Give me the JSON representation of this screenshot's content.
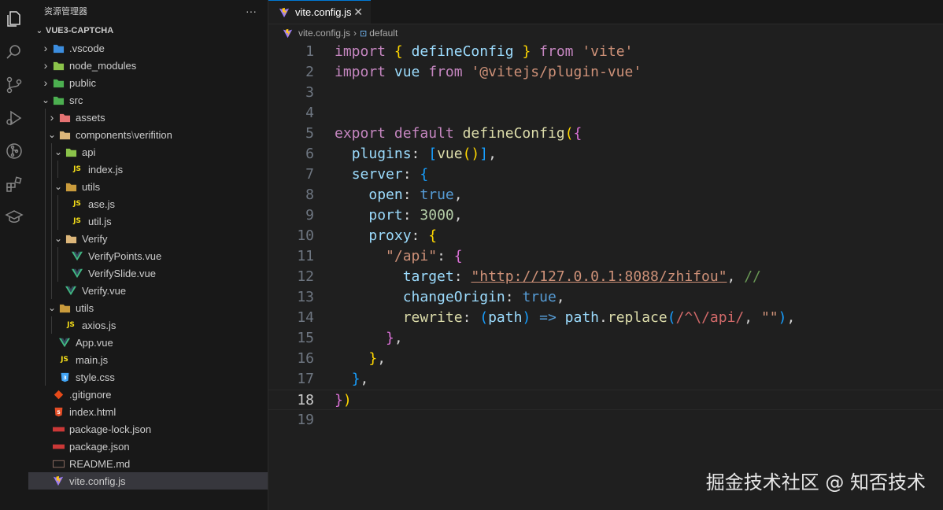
{
  "activity_bar": {
    "icons": [
      "files-icon",
      "search-icon",
      "source-control-icon",
      "run-debug-icon",
      "git-graph-icon",
      "extensions-icon",
      "education-icon"
    ]
  },
  "explorer": {
    "header": "资源管理器",
    "more": "···",
    "project": "VUE3-CAPTCHA",
    "items": [
      {
        "label": ".vscode",
        "depth": 1,
        "type": "folder",
        "icon": "vscode-folder",
        "color": "#3c8dde"
      },
      {
        "label": "node_modules",
        "depth": 1,
        "type": "folder",
        "icon": "node-folder",
        "color": "#8bc34a"
      },
      {
        "label": "public",
        "depth": 1,
        "type": "folder",
        "icon": "public-folder",
        "color": "#4caf50"
      },
      {
        "label": "src",
        "depth": 1,
        "type": "folder-open",
        "icon": "src-folder",
        "color": "#4caf50"
      },
      {
        "label": "assets",
        "depth": 2,
        "type": "folder",
        "icon": "assets-folder",
        "color": "#e57373"
      },
      {
        "label": "components",
        "sub": "verifition",
        "depth": 2,
        "type": "folder-open",
        "icon": "folder",
        "color": "#dcb67a"
      },
      {
        "label": "api",
        "depth": 3,
        "type": "folder-open",
        "icon": "api-folder",
        "color": "#8bc34a"
      },
      {
        "label": "index.js",
        "depth": 4,
        "type": "js",
        "icon": "js-file"
      },
      {
        "label": "utils",
        "depth": 3,
        "type": "folder-open",
        "icon": "utils-folder",
        "color": "#c99b3c"
      },
      {
        "label": "ase.js",
        "depth": 4,
        "type": "js",
        "icon": "js-file"
      },
      {
        "label": "util.js",
        "depth": 4,
        "type": "js",
        "icon": "js-file"
      },
      {
        "label": "Verify",
        "depth": 3,
        "type": "folder-open",
        "icon": "folder",
        "color": "#dcb67a"
      },
      {
        "label": "VerifyPoints.vue",
        "depth": 4,
        "type": "vue",
        "icon": "vue-file"
      },
      {
        "label": "VerifySlide.vue",
        "depth": 4,
        "type": "vue",
        "icon": "vue-file"
      },
      {
        "label": "Verify.vue",
        "depth": 3,
        "type": "vue",
        "icon": "vue-file"
      },
      {
        "label": "utils",
        "depth": 2,
        "type": "folder-open",
        "icon": "utils-folder",
        "color": "#c99b3c"
      },
      {
        "label": "axios.js",
        "depth": 3,
        "type": "js",
        "icon": "js-file"
      },
      {
        "label": "App.vue",
        "depth": 2,
        "type": "vue",
        "icon": "vue-file"
      },
      {
        "label": "main.js",
        "depth": 2,
        "type": "js",
        "icon": "js-file"
      },
      {
        "label": "style.css",
        "depth": 2,
        "type": "css",
        "icon": "css-file"
      },
      {
        "label": ".gitignore",
        "depth": 1,
        "type": "git",
        "icon": "git-file"
      },
      {
        "label": "index.html",
        "depth": 1,
        "type": "html",
        "icon": "html-file"
      },
      {
        "label": "package-lock.json",
        "depth": 1,
        "type": "npm",
        "icon": "npm-file"
      },
      {
        "label": "package.json",
        "depth": 1,
        "type": "npm",
        "icon": "npm-file"
      },
      {
        "label": "README.md",
        "depth": 1,
        "type": "md",
        "icon": "markdown-file"
      },
      {
        "label": "vite.config.js",
        "depth": 1,
        "type": "vite",
        "icon": "vite-file",
        "selected": true
      }
    ]
  },
  "editor": {
    "tab_label": "vite.config.js",
    "tab_close": "✕",
    "breadcrumb_file": "vite.config.js",
    "breadcrumb_sep": "›",
    "breadcrumb_symbol": "default",
    "current_line": 18,
    "lines": [
      [
        [
          "kw",
          "import"
        ],
        [
          "w",
          " "
        ],
        [
          "p1",
          "{"
        ],
        [
          "w",
          " "
        ],
        [
          "id",
          "defineConfig"
        ],
        [
          "w",
          " "
        ],
        [
          "p1",
          "}"
        ],
        [
          "w",
          " "
        ],
        [
          "kw",
          "from"
        ],
        [
          "w",
          " "
        ],
        [
          "str",
          "'vite'"
        ]
      ],
      [
        [
          "kw",
          "import"
        ],
        [
          "w",
          " "
        ],
        [
          "id",
          "vue"
        ],
        [
          "w",
          " "
        ],
        [
          "kw",
          "from"
        ],
        [
          "w",
          " "
        ],
        [
          "str",
          "'@vitejs/plugin-vue'"
        ]
      ],
      [],
      [],
      [
        [
          "kw",
          "export"
        ],
        [
          "w",
          " "
        ],
        [
          "kw",
          "default"
        ],
        [
          "w",
          " "
        ],
        [
          "fn",
          "defineConfig"
        ],
        [
          "p1",
          "("
        ],
        [
          "p2",
          "{"
        ]
      ],
      [
        [
          "w",
          "  "
        ],
        [
          "id",
          "plugins"
        ],
        [
          "w",
          ": "
        ],
        [
          "p3",
          "["
        ],
        [
          "fn",
          "vue"
        ],
        [
          "p1",
          "()"
        ],
        [
          "p3",
          "]"
        ],
        [
          "w",
          ","
        ]
      ],
      [
        [
          "w",
          "  "
        ],
        [
          "id",
          "server"
        ],
        [
          "w",
          ": "
        ],
        [
          "p3",
          "{"
        ]
      ],
      [
        [
          "w",
          "    "
        ],
        [
          "id",
          "open"
        ],
        [
          "w",
          ": "
        ],
        [
          "bool",
          "true"
        ],
        [
          "w",
          ","
        ]
      ],
      [
        [
          "w",
          "    "
        ],
        [
          "id",
          "port"
        ],
        [
          "w",
          ": "
        ],
        [
          "num",
          "3000"
        ],
        [
          "w",
          ","
        ]
      ],
      [
        [
          "w",
          "    "
        ],
        [
          "id",
          "proxy"
        ],
        [
          "w",
          ": "
        ],
        [
          "p1",
          "{"
        ]
      ],
      [
        [
          "w",
          "      "
        ],
        [
          "str",
          "\"/api\""
        ],
        [
          "w",
          ": "
        ],
        [
          "p2",
          "{"
        ]
      ],
      [
        [
          "w",
          "        "
        ],
        [
          "id",
          "target"
        ],
        [
          "w",
          ": "
        ],
        [
          "url",
          "\"http://127.0.0.1:8088/zhifou\""
        ],
        [
          "w",
          ", "
        ],
        [
          "cm",
          "//"
        ]
      ],
      [
        [
          "w",
          "        "
        ],
        [
          "id",
          "changeOrigin"
        ],
        [
          "w",
          ": "
        ],
        [
          "bool",
          "true"
        ],
        [
          "w",
          ","
        ]
      ],
      [
        [
          "w",
          "        "
        ],
        [
          "fn",
          "rewrite"
        ],
        [
          "w",
          ": "
        ],
        [
          "p3",
          "("
        ],
        [
          "id",
          "path"
        ],
        [
          "p3",
          ")"
        ],
        [
          "w",
          " "
        ],
        [
          "bool",
          "=>"
        ],
        [
          "w",
          " "
        ],
        [
          "id",
          "path"
        ],
        [
          "w",
          "."
        ],
        [
          "fn",
          "replace"
        ],
        [
          "p3",
          "("
        ],
        [
          "rx",
          "/^\\/api/"
        ],
        [
          "w",
          ", "
        ],
        [
          "str",
          "\"\""
        ],
        [
          "p3",
          ")"
        ],
        [
          "w",
          ","
        ]
      ],
      [
        [
          "w",
          "      "
        ],
        [
          "p2",
          "}"
        ],
        [
          "w",
          ","
        ]
      ],
      [
        [
          "w",
          "    "
        ],
        [
          "p1",
          "}"
        ],
        [
          "w",
          ","
        ]
      ],
      [
        [
          "w",
          "  "
        ],
        [
          "p3",
          "}"
        ],
        [
          "w",
          ","
        ]
      ],
      [
        [
          "p2",
          "}"
        ],
        [
          "p1",
          ")"
        ]
      ],
      []
    ]
  },
  "watermark": "掘金技术社区 @ 知否技术"
}
